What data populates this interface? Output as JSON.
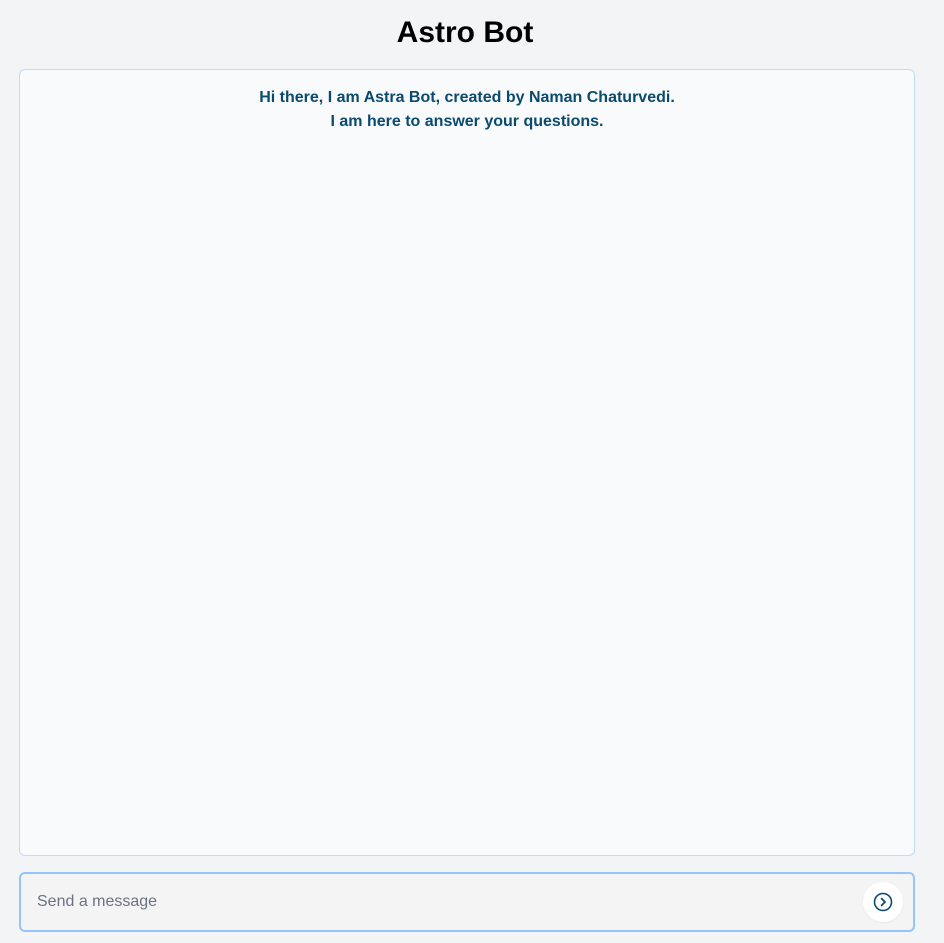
{
  "app": {
    "title": "Astro Bot"
  },
  "chat": {
    "greeting_line_1": "Hi there, I am Astra Bot, created by Naman Chaturvedi.",
    "greeting_line_2": "I am here to answer your questions."
  },
  "composer": {
    "placeholder": "Send a message",
    "value": "",
    "send_icon": "chevron-right-circle-icon"
  },
  "colors": {
    "background": "#f3f4f6",
    "chat_background": "#f8fafc",
    "chat_border": "#bfdbfe",
    "greeting_text": "#0b4a6f",
    "input_border": "#93c5fd",
    "send_icon": "#0b4a6f"
  }
}
